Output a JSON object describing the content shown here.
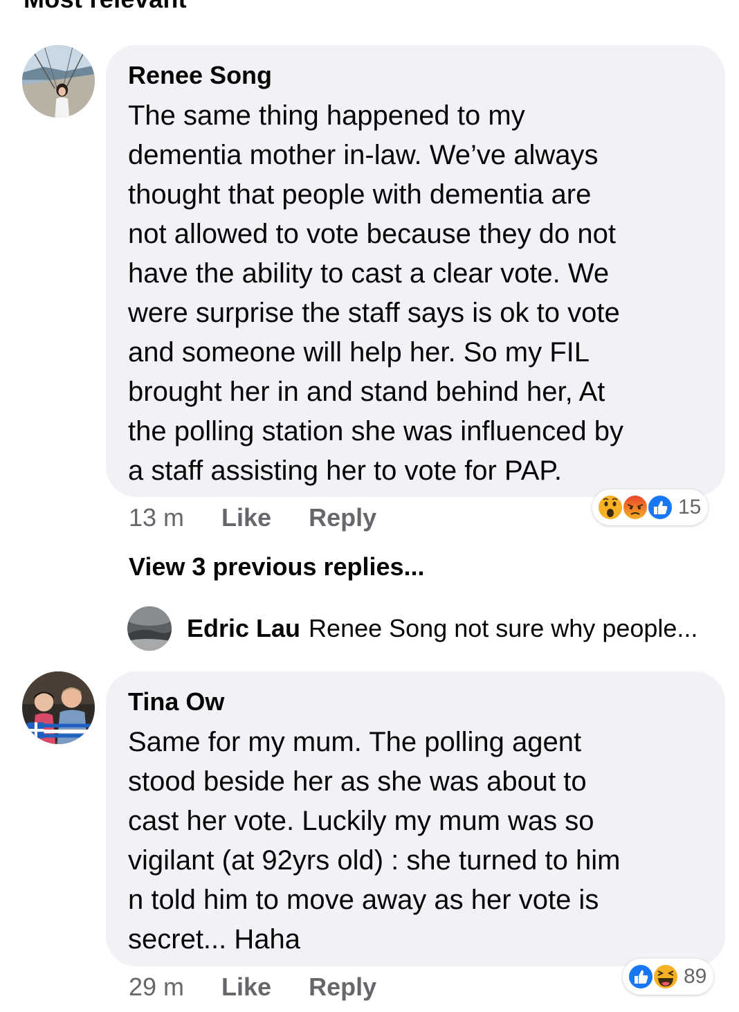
{
  "top_partial_text": "Most relevant",
  "comments": [
    {
      "author": "Renee Song",
      "text": "The same thing happened to my\ndementia mother in-law. We’ve always\nthought that people with dementia are\nnot allowed to vote because they do not\nhave the ability to cast a clear vote. We\nwere surprise the staff says is ok to vote\nand someone will help her. So my FIL\nbrought her in and stand behind her, At\nthe polling station she was influenced by\na staff assisting her to vote for PAP.",
      "time": "13 m",
      "like_label": "Like",
      "reply_label": "Reply",
      "reactions": [
        "wow-icon",
        "angry-icon",
        "like-icon"
      ],
      "reaction_count": "15"
    },
    {
      "author": "Tina Ow",
      "text": "Same for my mum.  The polling agent\nstood beside her as she was about to\ncast her vote.  Luckily my mum was so\nvigilant (at 92yrs old)  : she turned to him\nn told him to move away as her vote is\nsecret... Haha",
      "time": "29 m",
      "like_label": "Like",
      "reply_label": "Reply",
      "reactions": [
        "like-icon",
        "haha-icon"
      ],
      "reaction_count": "89"
    }
  ],
  "view_previous_replies": "View 3 previous replies...",
  "reply_preview": {
    "author": "Edric Lau",
    "snippet": "Renee Song not sure why people..."
  },
  "colors": {
    "bubble": "#f0f2f5",
    "secondary_text": "#65676b",
    "like_blue": "#1877f2",
    "angry_orange": "#e9710f",
    "wow_yellow": "#f7b125"
  }
}
